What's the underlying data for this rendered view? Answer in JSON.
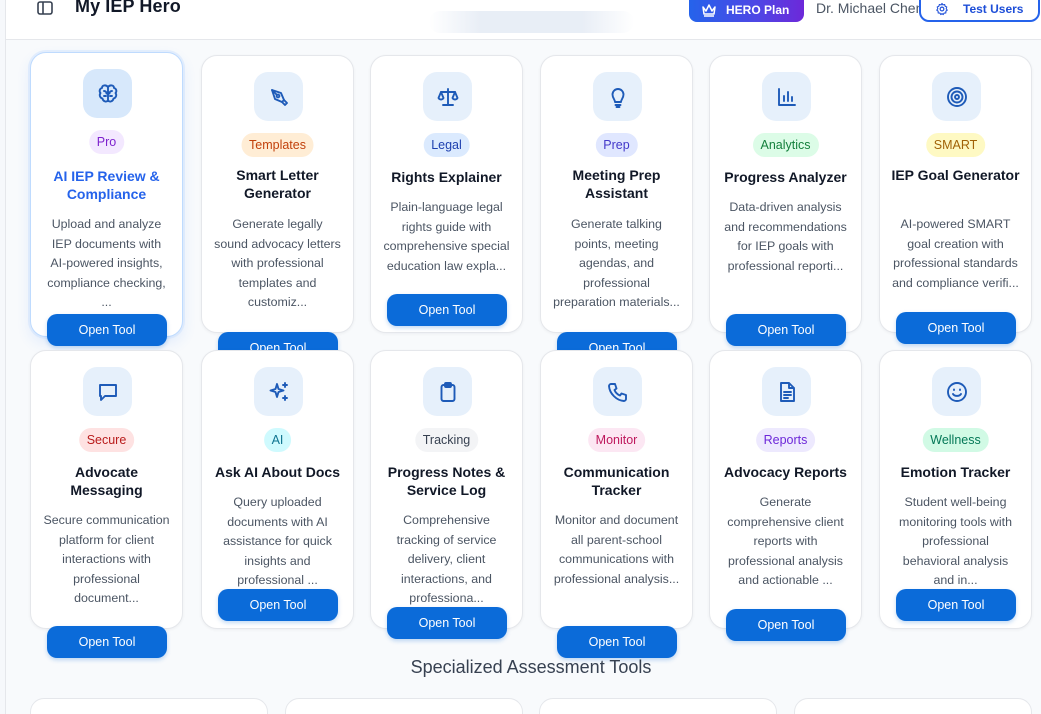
{
  "header": {
    "app_title": "My IEP Hero",
    "plan_label": "HERO Plan",
    "user_name": "Dr. Michael Chen",
    "test_users_label": "Test Users"
  },
  "colors": {
    "primary_button": "#0b6bd9",
    "plan_gradient_start": "#2563eb",
    "plan_gradient_end": "#6d28d9",
    "icon_bg": "#e6f0fb"
  },
  "tools": [
    {
      "title": "AI IEP Review & Compliance",
      "badge": "Pro",
      "icon": "brain-icon",
      "description": "Upload and analyze IEP documents with AI-powered insights, compliance checking, ...",
      "button": "Open Tool",
      "active": true
    },
    {
      "title": "Smart Letter Generator",
      "badge": "Templates",
      "icon": "pen-tool-icon",
      "description": "Generate legally sound advocacy letters with professional templates and customiz...",
      "button": "Open Tool"
    },
    {
      "title": "Rights Explainer",
      "badge": "Legal",
      "icon": "scale-icon",
      "description": "Plain-language legal rights guide with comprehensive special education law expla...",
      "button": "Open Tool"
    },
    {
      "title": "Meeting Prep Assistant",
      "badge": "Prep",
      "icon": "lightbulb-icon",
      "description": "Generate talking points, meeting agendas, and professional preparation materials...",
      "button": "Open Tool"
    },
    {
      "title": "Progress Analyzer",
      "badge": "Analytics",
      "icon": "bar-chart-icon",
      "description": "Data-driven analysis and recommendations for IEP goals with professional reporti...",
      "button": "Open Tool"
    },
    {
      "title": "IEP Goal Generator",
      "badge": "SMART",
      "icon": "target-icon",
      "description": "AI-powered SMART goal creation with professional standards and compliance verifi...",
      "button": "Open Tool"
    },
    {
      "title": "Advocate Messaging",
      "badge": "Secure",
      "icon": "message-icon",
      "description": "Secure communication platform for client interactions with professional document...",
      "button": "Open Tool"
    },
    {
      "title": "Ask AI About Docs",
      "badge": "AI",
      "icon": "sparkles-icon",
      "description": "Query uploaded documents with AI assistance for quick insights and professional ...",
      "button": "Open Tool"
    },
    {
      "title": "Progress Notes & Service Log",
      "badge": "Tracking",
      "icon": "clipboard-icon",
      "description": "Comprehensive tracking of service delivery, client interactions, and professiona...",
      "button": "Open Tool"
    },
    {
      "title": "Communication Tracker",
      "badge": "Monitor",
      "icon": "phone-icon",
      "description": "Monitor and document all parent-school communications with professional analysis...",
      "button": "Open Tool"
    },
    {
      "title": "Advocacy Reports",
      "badge": "Reports",
      "icon": "file-text-icon",
      "description": "Generate comprehensive client reports with professional analysis and actionable ...",
      "button": "Open Tool"
    },
    {
      "title": "Emotion Tracker",
      "badge": "Wellness",
      "icon": "smile-icon",
      "description": "Student well-being monitoring tools with professional behavioral analysis and in...",
      "button": "Open Tool"
    }
  ],
  "section": {
    "title": "Specialized Assessment Tools"
  }
}
